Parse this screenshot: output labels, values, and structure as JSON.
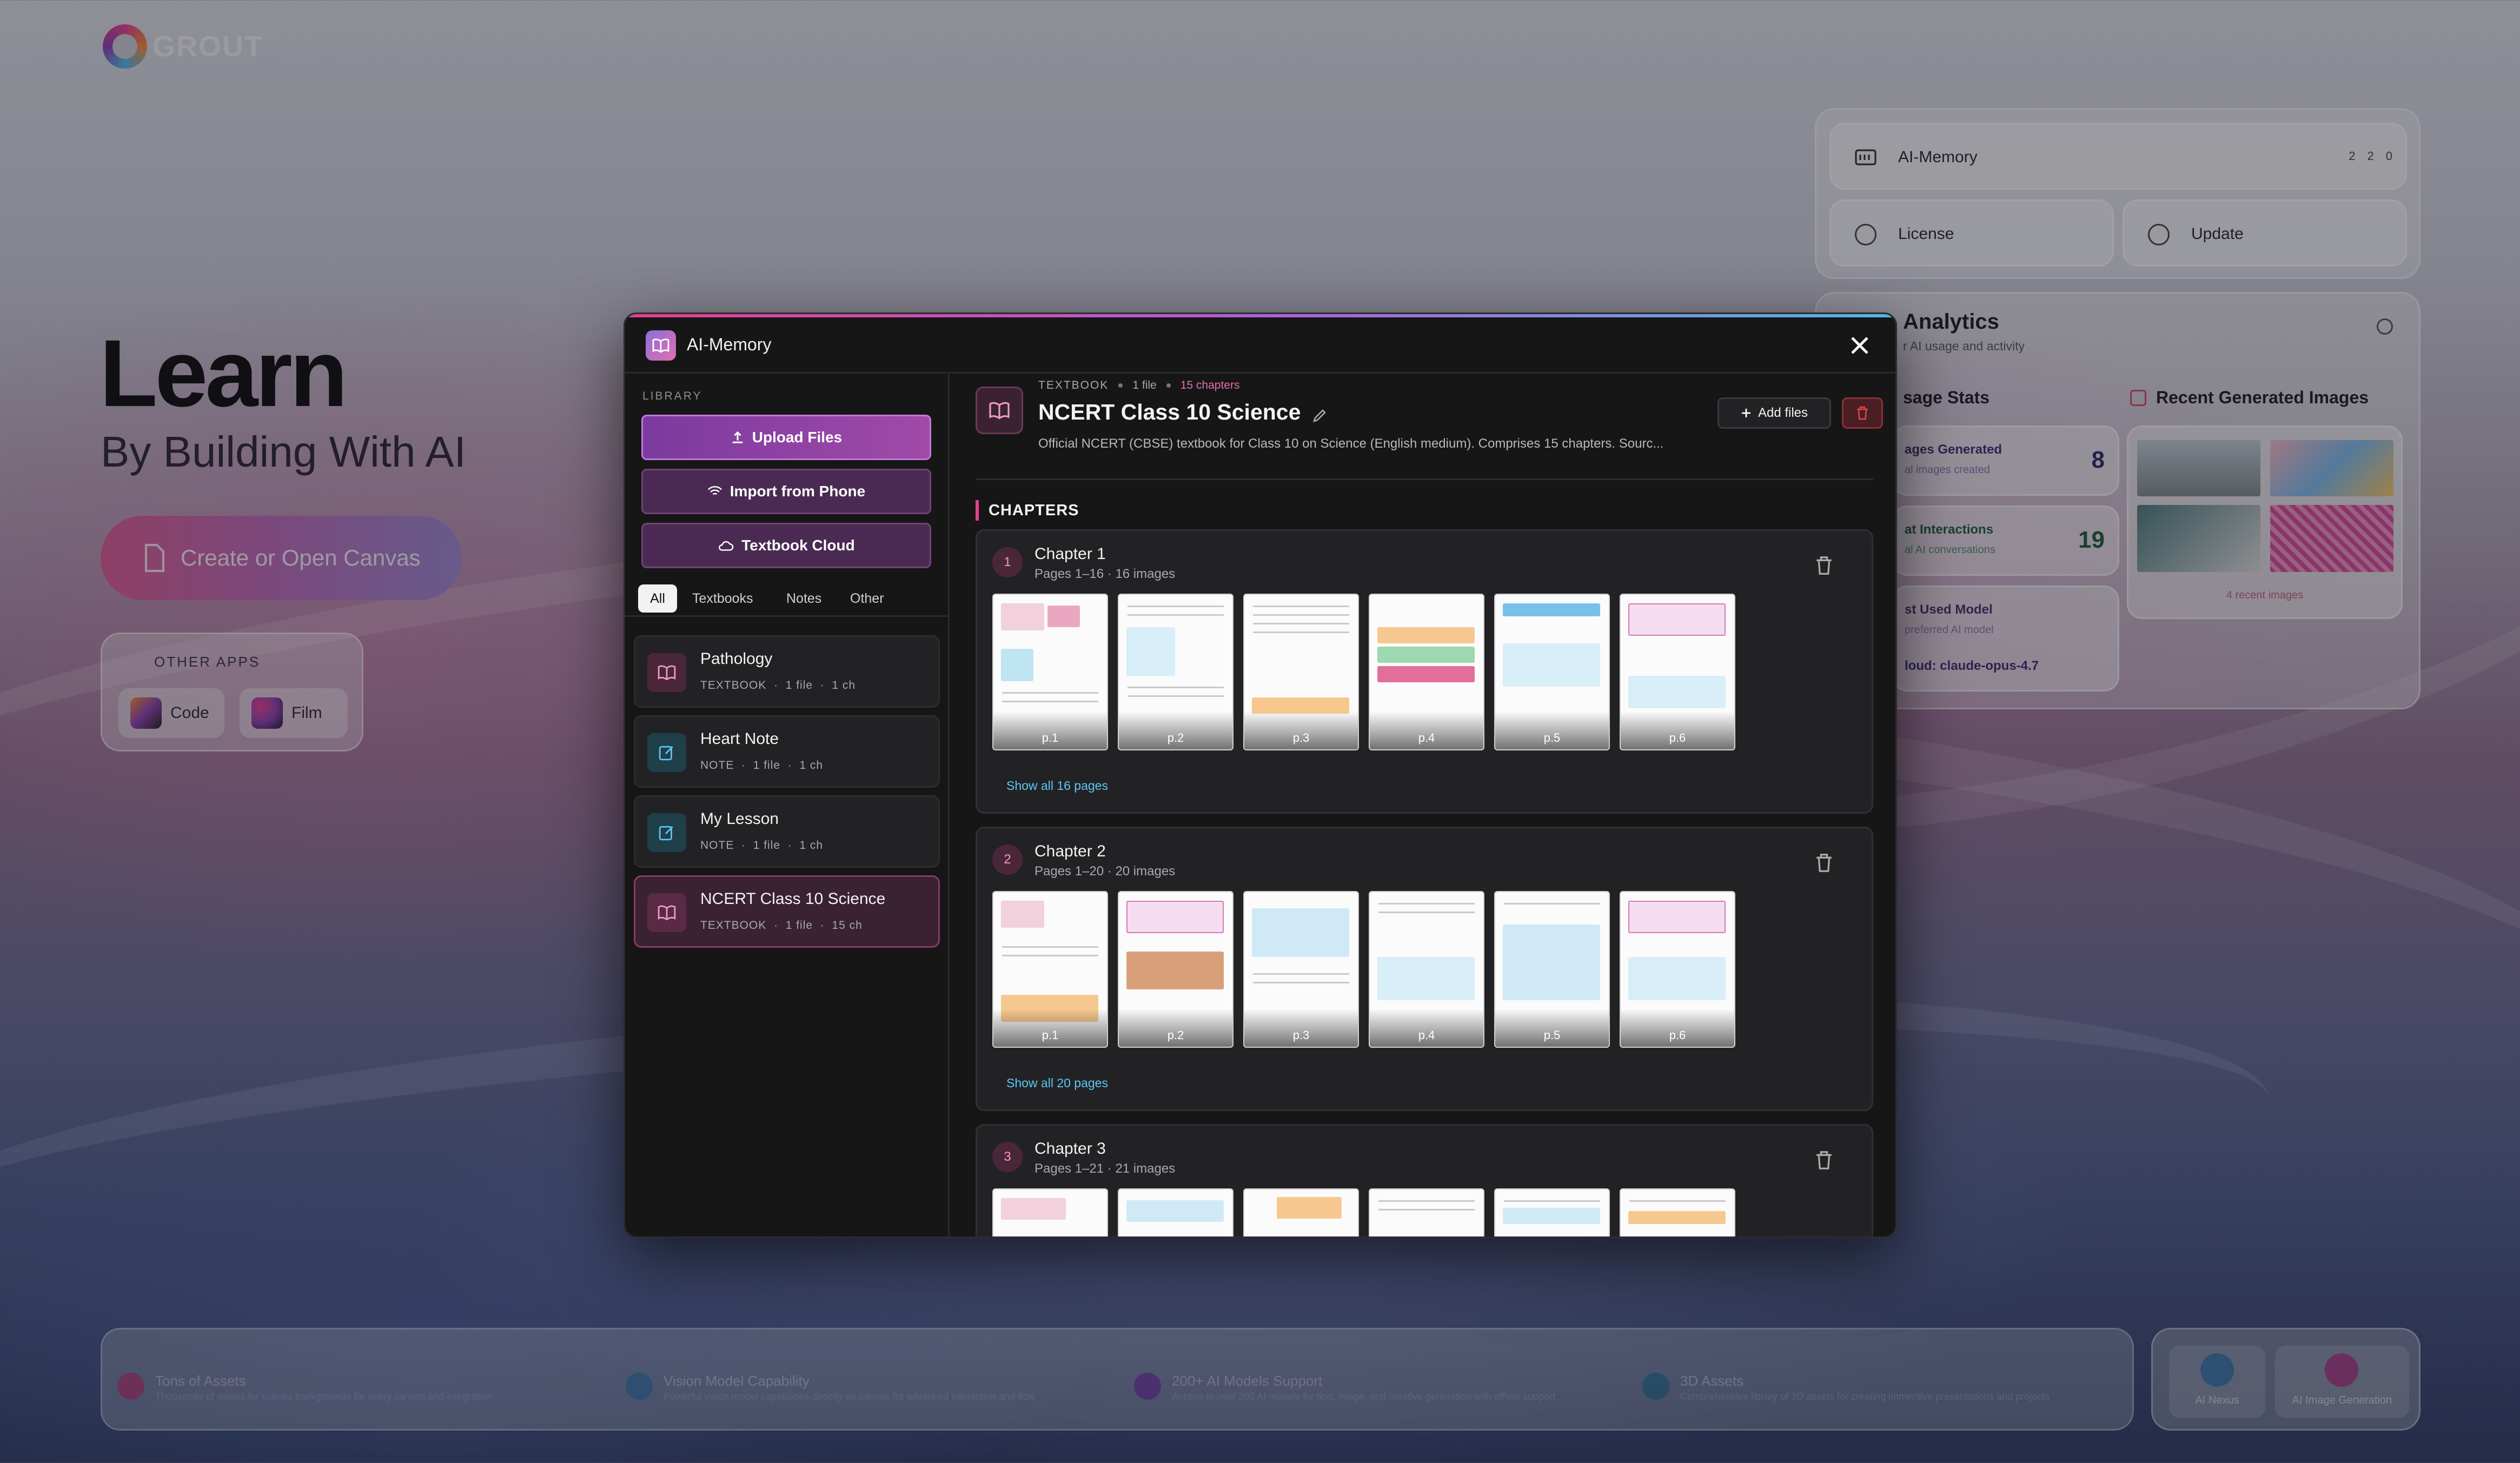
{
  "app": {
    "brand": "GROUT"
  },
  "hero": {
    "title": "Learn",
    "subtitle": "By Building With AI",
    "cta": "Create or Open Canvas"
  },
  "other_apps": {
    "label": "OTHER APPS",
    "items": [
      {
        "label": "Code"
      },
      {
        "label": "Film"
      }
    ]
  },
  "right_panel": {
    "memory": {
      "label": "AI-Memory",
      "counts": [
        "2",
        "2",
        "0"
      ]
    },
    "license": "License",
    "update": "Update",
    "analytics": {
      "title": "Analytics",
      "subtitle": "r AI usage and activity",
      "usage_stats": "sage Stats",
      "images_generated": {
        "label": "ages Generated",
        "sub": "al images created",
        "value": "8"
      },
      "interactions": {
        "label": "at Interactions",
        "sub": "al AI conversations",
        "value": "19"
      },
      "model": {
        "label": "st Used Model",
        "sub": "preferred AI model",
        "value": "loud: claude-opus-4.7"
      },
      "recent_images": "Recent Generated Images",
      "recent_count": "4 recent images"
    }
  },
  "bottom_bar": {
    "features": [
      {
        "title": "Tons of Assets",
        "desc": "Thousands of assets for scenes backgrounds for every canvas and integration"
      },
      {
        "title": "Vision Model Capability",
        "desc": "Powerful vision model capabilities directly on canvas for advanced interaction and flow"
      },
      {
        "title": "200+ AI Models Support",
        "desc": "Access to over 200 AI models for text, image, and creative generation with offline support"
      },
      {
        "title": "3D Assets",
        "desc": "Comprehensive library of 3D assets for creating immersive presentations and projects"
      }
    ],
    "quick": [
      {
        "label": "AI Nexus"
      },
      {
        "label": "AI Image Generation"
      }
    ]
  },
  "modal": {
    "title": "AI-Memory",
    "library_label": "LIBRARY",
    "buttons": {
      "upload": "Upload Files",
      "phone": "Import from Phone",
      "cloud": "Textbook Cloud"
    },
    "tabs": [
      {
        "label": "All"
      },
      {
        "label": "Textbooks"
      },
      {
        "label": "Notes"
      },
      {
        "label": "Other"
      }
    ],
    "items": [
      {
        "title": "Pathology",
        "type": "TEXTBOOK",
        "files": "1 file",
        "ch": "1 ch"
      },
      {
        "title": "Heart Note",
        "type": "NOTE",
        "files": "1 file",
        "ch": "1 ch"
      },
      {
        "title": "My Lesson",
        "type": "NOTE",
        "files": "1 file",
        "ch": "1 ch"
      },
      {
        "title": "NCERT Class 10 Science",
        "type": "TEXTBOOK",
        "files": "1 file",
        "ch": "15 ch"
      }
    ],
    "sep": "·",
    "detail": {
      "type": "TEXTBOOK",
      "files": "1 file",
      "chapters_count": "15 chapters",
      "title": "NCERT Class 10 Science",
      "description": "Official NCERT (CBSE) textbook for Class 10 on Science (English medium). Comprises 15 chapters. Sourc...",
      "add_files": "Add files",
      "chapters_label": "CHAPTERS",
      "chapters": [
        {
          "num": "1",
          "title": "Chapter 1",
          "meta": "Pages 1–16 · 16 images",
          "show_all": "Show all 16 pages",
          "pages": [
            "p.1",
            "p.2",
            "p.3",
            "p.4",
            "p.5",
            "p.6"
          ]
        },
        {
          "num": "2",
          "title": "Chapter 2",
          "meta": "Pages 1–20 · 20 images",
          "show_all": "Show all 20 pages",
          "pages": [
            "p.1",
            "p.2",
            "p.3",
            "p.4",
            "p.5",
            "p.6"
          ]
        },
        {
          "num": "3",
          "title": "Chapter 3",
          "meta": "Pages 1–21 · 21 images",
          "show_all": "",
          "pages": [
            "",
            "",
            "",
            "",
            "",
            ""
          ]
        }
      ]
    }
  },
  "colors": {
    "accent_pink": "#e2408f",
    "accent_purple": "#8e3fae",
    "link": "#5cc6f2",
    "danger": "#e0454a"
  }
}
